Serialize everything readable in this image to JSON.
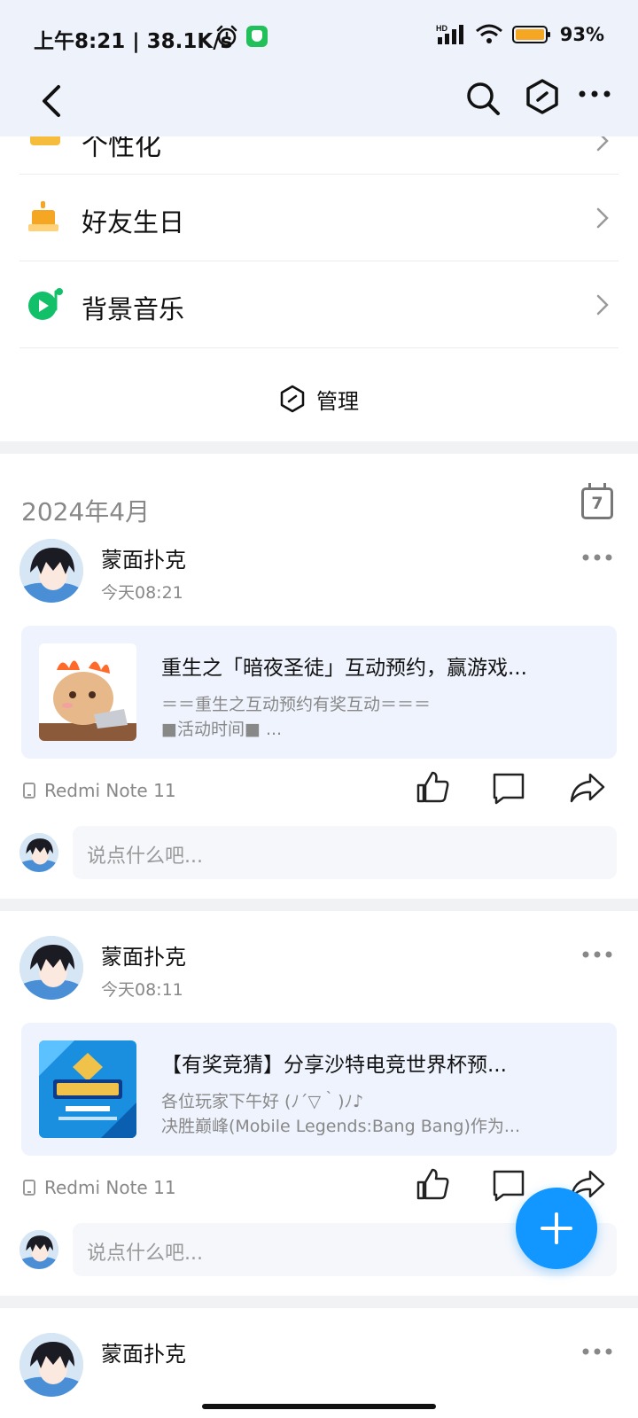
{
  "status_bar": {
    "time_speed": "上午8:21 | 38.1K/s",
    "battery_percent": "93%",
    "network_label": "HD"
  },
  "nav": {
    "back_icon": "chevron-left-icon",
    "search_icon": "search-icon",
    "manage_icon": "hexagon-icon",
    "more_icon": "more-icon"
  },
  "menu": {
    "partial_item": "个性化",
    "items": [
      {
        "label": "好友生日",
        "icon": "birthday-cake-icon"
      },
      {
        "label": "背景音乐",
        "icon": "music-icon"
      }
    ],
    "manage_label": "管理"
  },
  "feed": {
    "month_label": "2024年4月",
    "calendar_day": "7",
    "comment_placeholder": "说点什么吧...",
    "posts": [
      {
        "author": "蒙面扑克",
        "time": "今天08:21",
        "card_title": "重生之「暗夜圣徒」互动预约，赢游戏...",
        "card_line1": "＝＝重生之互动预约有奖互动＝＝＝",
        "card_line2": "■活动时间■ ...",
        "device": "Redmi Note 11"
      },
      {
        "author": "蒙面扑克",
        "time": "今天08:11",
        "card_title": "【有奖竞猜】分享沙特电竞世界杯预...",
        "card_line1": "各位玩家下午好 (ﾉ´▽｀)ﾉ♪",
        "card_line2": "决胜巅峰(Mobile Legends:Bang Bang)作为...",
        "device": "Redmi Note 11"
      },
      {
        "author": "蒙面扑克"
      }
    ]
  },
  "colors": {
    "header_bg": "#eef2fb",
    "card_bg": "#eef3fd",
    "fab": "#1296ff",
    "section_gap": "#f1f2f4"
  }
}
